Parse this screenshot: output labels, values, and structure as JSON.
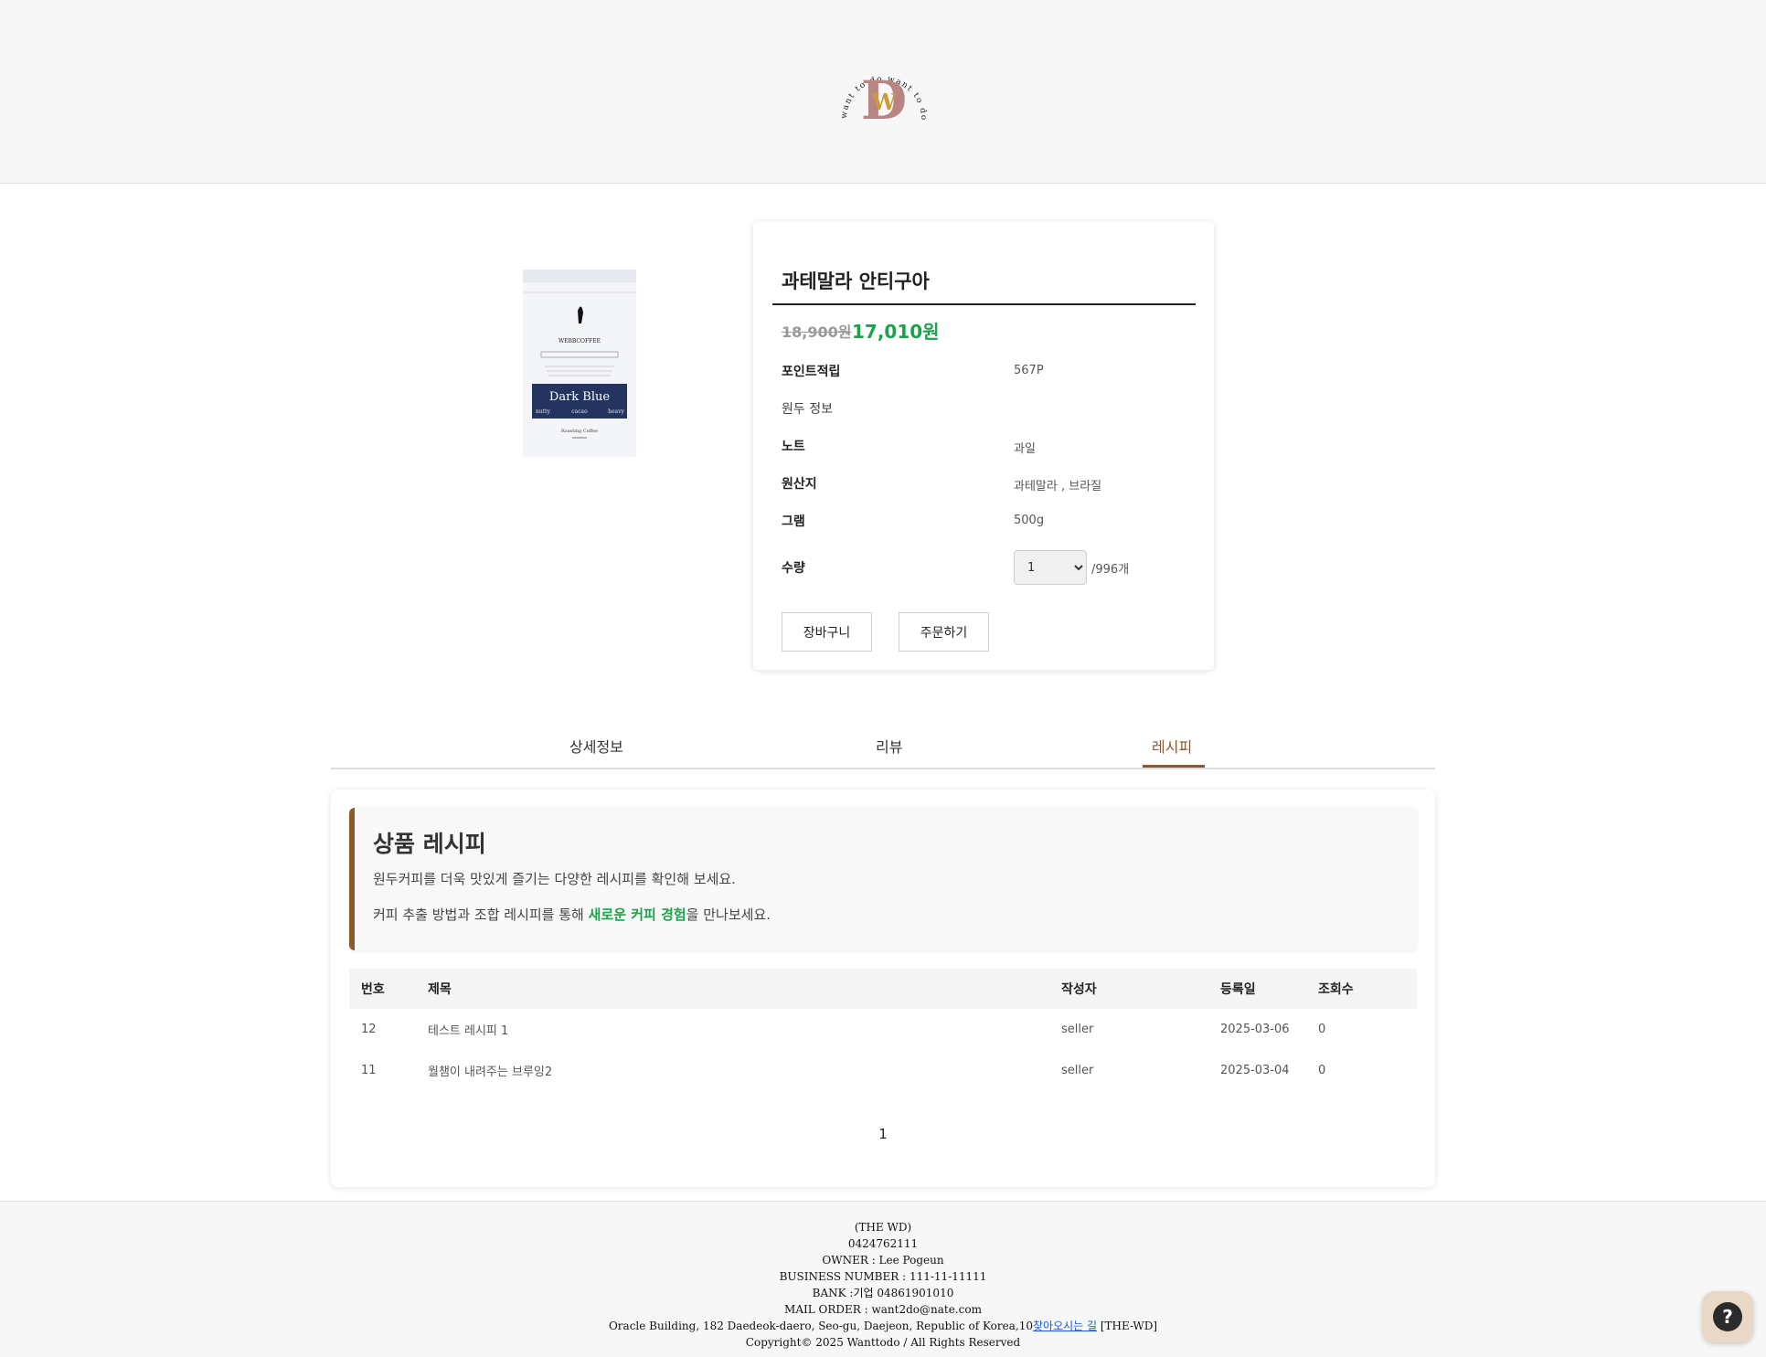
{
  "header": {
    "logo": {
      "icon": "wd-circle-logo-icon",
      "ring_text": "want to do want to do want to do",
      "monogram": "W",
      "letter": "D"
    }
  },
  "product": {
    "image": {
      "icon": "coffee-bag-image",
      "brand": "WEBBCOFFEE",
      "label": "Dark Blue",
      "tags": [
        "nutty",
        "cacao",
        "heavy"
      ],
      "footer": "Roasting Coffee"
    },
    "title": "과테말라 안티구아",
    "price_original": "18,900원",
    "price_sale": "17,010원",
    "rows": [
      {
        "label": "포인트적립",
        "value": "567P"
      },
      {
        "label": "원두 정보",
        "value": ""
      },
      {
        "label": "노트",
        "value": "과일"
      },
      {
        "label": "원산지",
        "value": "과테말라 , 브라질"
      },
      {
        "label": "그램",
        "value": "500g"
      }
    ],
    "quantity": {
      "label": "수량",
      "selected": "1",
      "stock": "/996개"
    },
    "buttons": {
      "cart": "장바구니",
      "order": "주문하기"
    }
  },
  "tabs": [
    {
      "label": "상세정보",
      "active": false
    },
    {
      "label": "리뷰",
      "active": false
    },
    {
      "label": "레시피",
      "active": true
    }
  ],
  "recipe": {
    "title": "상품 레시피",
    "line1": "원두커피를 더욱 맛있게 즐기는 다양한 레시피를 확인해 보세요.",
    "line2_pre": "커피 추출 방법과 조합 레시피를 통해 ",
    "line2_highlight": "새로운 커피 경험",
    "line2_post": "을 만나보세요.",
    "columns": [
      "번호",
      "제목",
      "작성자",
      "등록일",
      "조회수"
    ],
    "rows": [
      [
        "12",
        "테스트 레시피 1",
        "seller",
        "2025-03-06",
        "0"
      ],
      [
        "11",
        "월챔이 내려주는 브루잉2",
        "seller",
        "2025-03-04",
        "0"
      ]
    ],
    "page": "1"
  },
  "footer": {
    "company": "(THE WD)",
    "phone": "0424762111",
    "owner": "OWNER : Lee Pogeun",
    "business": "BUSINESS NUMBER : 111-11-11111",
    "bank": "BANK :기업 04861901010",
    "mail": "MAIL ORDER : want2do@nate.com",
    "address": "Oracle Building, 182 Daedeok-daero, Seo-gu, Daejeon, Republic of Korea,10",
    "directions_link": "찾아오시는 길",
    "address_tail": " [THE-WD]",
    "copyright": "Copyright© 2025 Wanttodo / All Rights Reserved"
  },
  "help_button": {
    "icon": "help-question-icon",
    "glyph": "?"
  },
  "colors": {
    "accent_brown": "#8b5a2b",
    "price_green": "#1aa34a",
    "label_navy": "#24345e",
    "link_blue": "#1a5fd6"
  }
}
